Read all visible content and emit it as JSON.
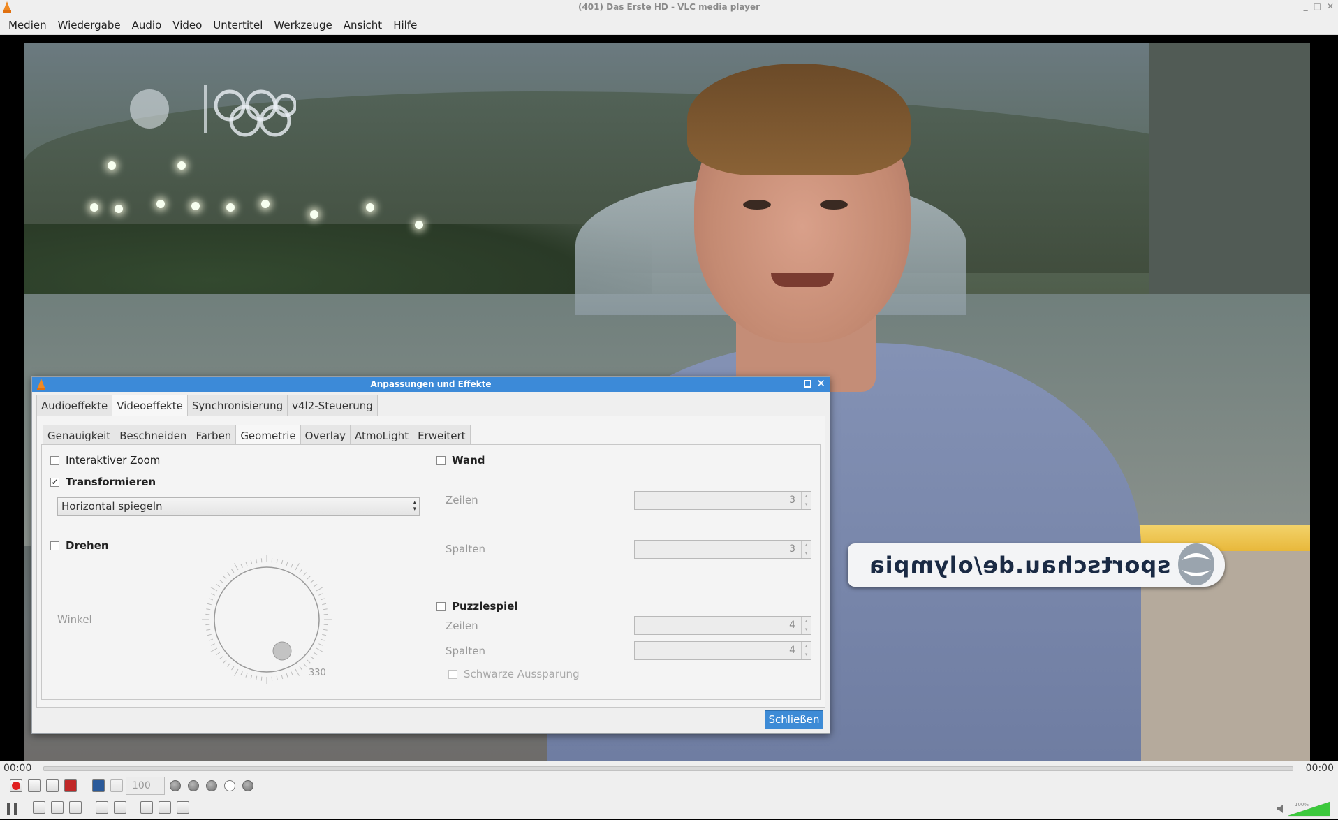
{
  "window": {
    "title": "(401) Das Erste HD - VLC media player",
    "controls": [
      "_",
      "□",
      "✕"
    ]
  },
  "menu": [
    "Medien",
    "Wiedergabe",
    "Audio",
    "Video",
    "Untertitel",
    "Werkzeuge",
    "Ansicht",
    "Hilfe"
  ],
  "video": {
    "banner_text": "sportschau.de/olympia"
  },
  "dialog": {
    "title": "Anpassungen und Effekte",
    "tabs": [
      "Audioeffekte",
      "Videoeffekte",
      "Synchronisierung",
      "v4l2-Steuerung"
    ],
    "active_tab": "Videoeffekte",
    "subtabs": [
      "Genauigkeit",
      "Beschneiden",
      "Farben",
      "Geometrie",
      "Overlay",
      "AtmoLight",
      "Erweitert"
    ],
    "active_subtab": "Geometrie",
    "geometry": {
      "interactive_zoom": {
        "label": "Interaktiver Zoom",
        "checked": false
      },
      "transform": {
        "label": "Transformieren",
        "checked": true,
        "check_glyph": "✓",
        "selected": "Horizontal spiegeln"
      },
      "rotate": {
        "label": "Drehen",
        "checked": false,
        "angle_label": "Winkel",
        "angle_value": "330"
      },
      "wall": {
        "label": "Wand",
        "checked": false,
        "rows_label": "Zeilen",
        "rows_value": "3",
        "cols_label": "Spalten",
        "cols_value": "3"
      },
      "puzzle": {
        "label": "Puzzlespiel",
        "checked": false,
        "rows_label": "Zeilen",
        "rows_value": "4",
        "cols_label": "Spalten",
        "cols_value": "4",
        "black_slot_label": "Schwarze Aussparung",
        "black_slot_checked": false
      }
    },
    "close_button": "Schließen"
  },
  "playback": {
    "time_elapsed": "00:00",
    "time_total": "00:00",
    "rate": "100",
    "volume_percent": 100,
    "volume_text": "100%"
  },
  "colors": {
    "accent": "#3c8ad8",
    "record": "#e02020",
    "volume": "#3cc93c"
  }
}
